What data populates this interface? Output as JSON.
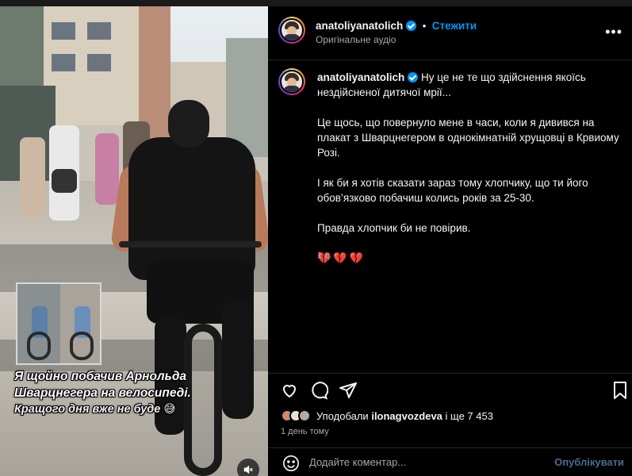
{
  "header": {
    "username": "anatoliyanatolich",
    "follow_label": "Стежити",
    "audio_label": "Оригінальне аудіо",
    "more_icon": "more-horizontal-icon"
  },
  "post": {
    "username": "anatoliyanatolich",
    "first_line": "Ну це не те що здійснення якоїсь нездійсненої дитячої мрії...",
    "paragraphs": [
      "Це щось, що повернуло мене в часи, коли я дивився на плакат з Шварцнегером в однокімнатній хрущовці в Крвиому Розі.",
      "І як би я хотів сказати зараз тому хлопчику, що ти його обов’язково побачиш колись років за 25-30.",
      "Правда хлопчик би не повірив."
    ],
    "hearts": "💔💔💔",
    "time": "1 д."
  },
  "media": {
    "caption_line1": "Я щойно побачив Арнольда",
    "caption_line2": "Шварцнегера на велосипеді.",
    "caption_line3": "Кращого дня вже не буде 😅",
    "mute_icon": "speaker-muted-icon"
  },
  "actions": {
    "like_icon": "heart-icon",
    "comment_icon": "comment-icon",
    "share_icon": "send-icon",
    "save_icon": "bookmark-icon"
  },
  "likes": {
    "prefix": "Уподобали",
    "user": "ilonagvozdeva",
    "suffix": "і ще 7 453"
  },
  "date": "1 день тому",
  "comment": {
    "emoji_icon": "emoji-icon",
    "placeholder": "Додайте коментар...",
    "publish_label": "Опублікувати"
  },
  "colors": {
    "accent": "#0095f6",
    "background": "#000000",
    "muted_text": "#a8a8a8",
    "hearts": "#e0245e"
  }
}
